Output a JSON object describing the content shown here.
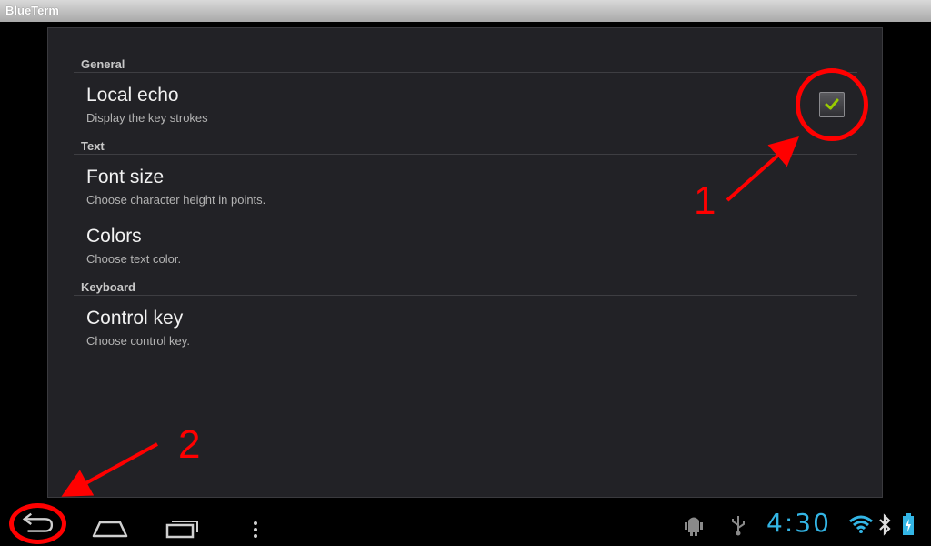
{
  "app": {
    "title": "BlueTerm"
  },
  "preferences": {
    "sections": [
      {
        "header": "General",
        "items": [
          {
            "title": "Local echo",
            "summary": "Display the key strokes",
            "checked": true
          }
        ]
      },
      {
        "header": "Text",
        "items": [
          {
            "title": "Font size",
            "summary": "Choose character height in points."
          },
          {
            "title": "Colors",
            "summary": "Choose text color."
          }
        ]
      },
      {
        "header": "Keyboard",
        "items": [
          {
            "title": "Control key",
            "summary": "Choose control key."
          }
        ]
      }
    ]
  },
  "annotations": {
    "label_1": "1",
    "label_2": "2",
    "color": "#ff0000"
  },
  "navbar": {
    "buttons": [
      "back-icon",
      "home-icon",
      "recent-apps-icon",
      "menu-overflow-icon"
    ]
  },
  "status": {
    "time": "4:30",
    "icons": [
      "android-debug-icon",
      "usb-icon",
      "wifi-icon",
      "bluetooth-icon",
      "battery-charging-icon"
    ],
    "accent_color": "#33b5e5"
  }
}
